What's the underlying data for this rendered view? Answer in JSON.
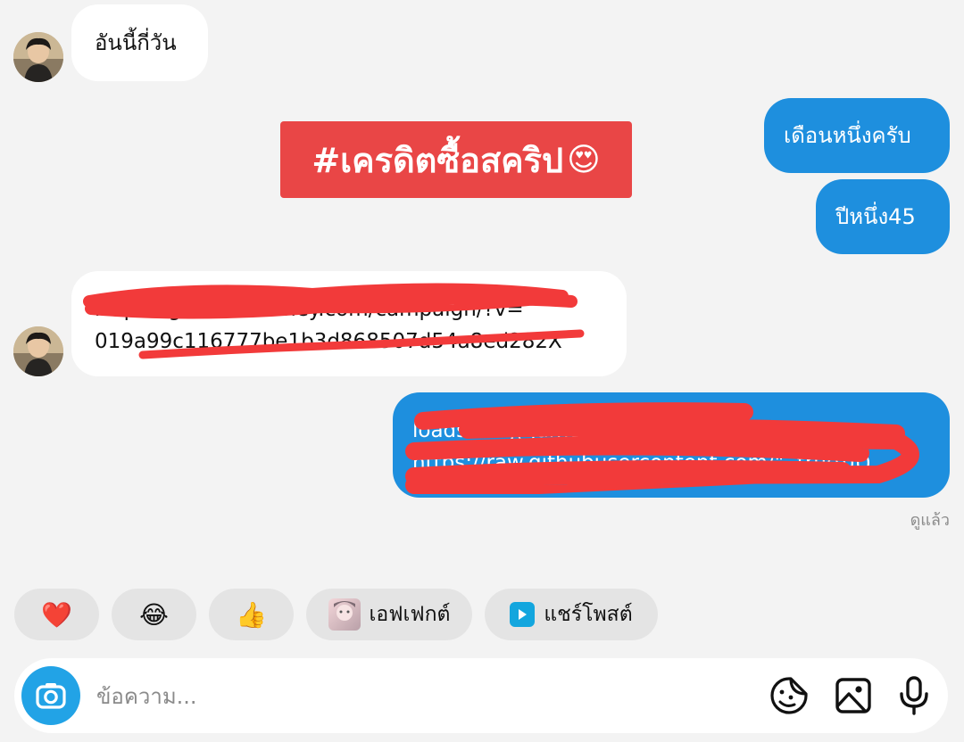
{
  "messages": {
    "m1": "อันนี้กี่วัน",
    "m2": "เดือนหนึ่งครับ",
    "m3": "ปีหนึ่ง45",
    "link_line1": "https://gift.truemoney.com/campaign/?v=",
    "link_line2": "019a99c116777be1b3d868507d54a8ed282X",
    "code_line1": "loadstring(game:HttpGet(\"",
    "code_line2": "https://raw.githubusercontent.com/\", true))()"
  },
  "sticker": {
    "text": "#เครดิตซื้อสคริป",
    "emoji": "😍"
  },
  "status": {
    "seen": "ดูแล้ว"
  },
  "reactions": {
    "heart": "❤️",
    "laugh": "😂",
    "thumbs": "👍",
    "effect_label": "เอฟเฟกต์",
    "share_label": "แชร์โพสต์"
  },
  "composer": {
    "placeholder": "ข้อความ..."
  },
  "colors": {
    "outgoing_bubble": "#1e8fde",
    "incoming_bubble": "#ffffff",
    "sticker_bg": "#e94646",
    "redaction": "#f23a3a",
    "camera_button": "#22a3e6"
  },
  "icons": [
    "camera-icon",
    "sticker-icon",
    "gallery-icon",
    "microphone-icon",
    "play-icon"
  ]
}
